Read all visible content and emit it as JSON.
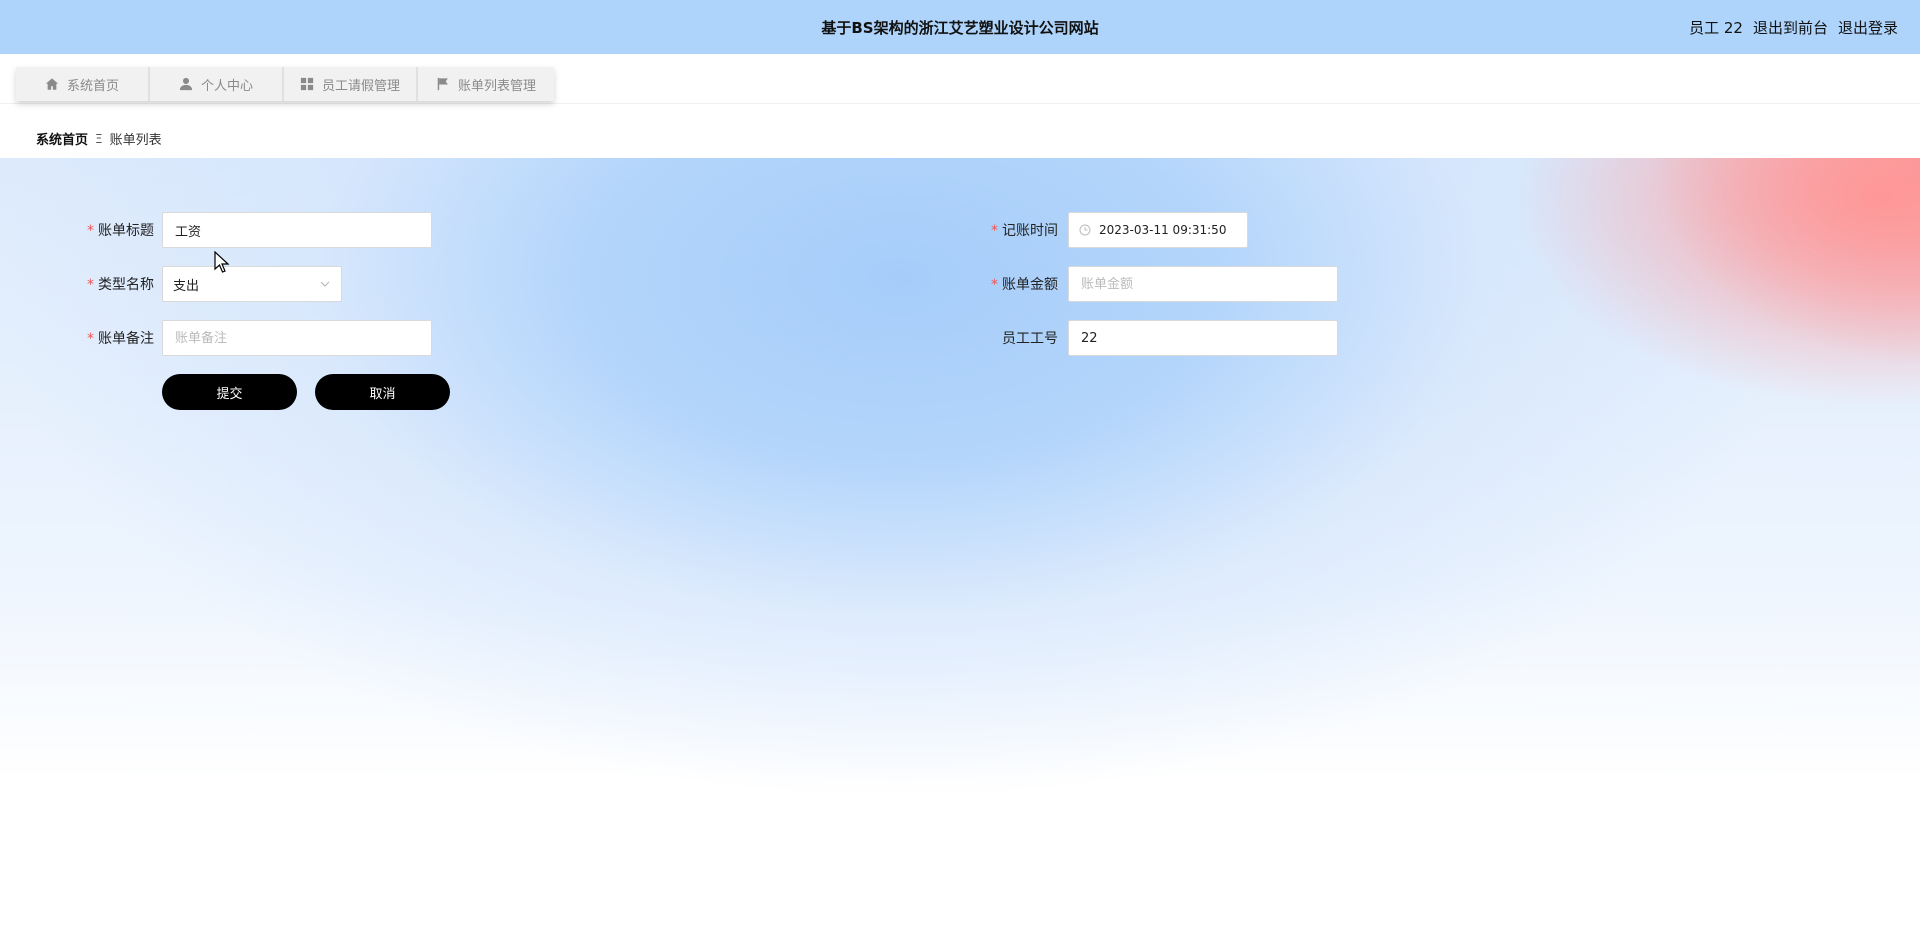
{
  "header": {
    "title": "基于BS架构的浙江艾艺塑业设计公司网站",
    "user_label": "员工 22",
    "back_to_front": "退出到前台",
    "logout": "退出登录",
    "bg_color": "#aed4fb"
  },
  "nav": {
    "tabs": [
      {
        "label": "系统首页",
        "icon": "home-icon"
      },
      {
        "label": "个人中心",
        "icon": "user-icon"
      },
      {
        "label": "员工请假管理",
        "icon": "grid-icon"
      },
      {
        "label": "账单列表管理",
        "icon": "flag-icon"
      }
    ]
  },
  "breadcrumb": {
    "home": "系统首页",
    "separator": "Ξ",
    "current": "账单列表"
  },
  "form": {
    "title_label": "账单标题",
    "title_value": "工资",
    "type_label": "类型名称",
    "type_value": "支出",
    "note_label": "账单备注",
    "note_placeholder": "账单备注",
    "time_label": "记账时间",
    "time_value": "2023-03-11 09:31:50",
    "amount_label": "账单金额",
    "amount_placeholder": "账单金额",
    "staff_label": "员工工号",
    "staff_value": "22",
    "submit": "提交",
    "cancel": "取消",
    "required_mark": "*"
  }
}
